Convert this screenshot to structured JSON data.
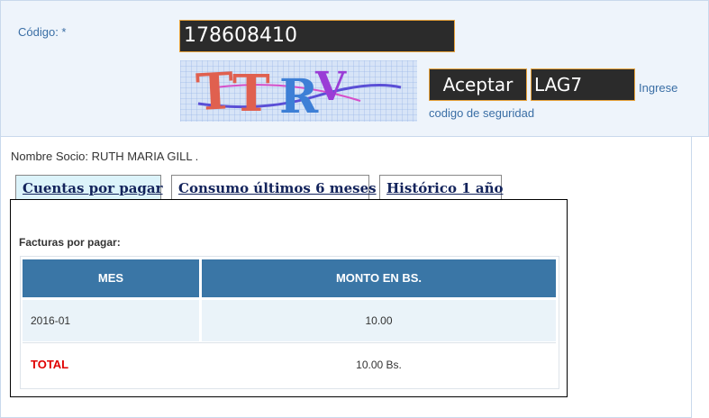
{
  "form": {
    "codigo_label": "Código: *",
    "codigo_value": "178608410",
    "captcha_text": "TTRV",
    "accept_label": "Aceptar",
    "security_value": "LAG7",
    "hint_part1": "Ingrese",
    "hint_part2": "codigo de seguridad"
  },
  "socio": {
    "label": "Nombre Socio: RUTH MARIA GILL ."
  },
  "tabs": [
    {
      "label": "Cuentas por pagar",
      "active": true
    },
    {
      "label": "Consumo últimos 6 meses",
      "active": false
    },
    {
      "label": "Histórico 1 año",
      "active": false
    }
  ],
  "facturas": {
    "title": "Facturas por pagar:",
    "headers": [
      "MES",
      "MONTO EN BS."
    ],
    "rows": [
      {
        "mes": "2016-01",
        "monto": "10.00"
      }
    ],
    "total_label": "TOTAL",
    "total_value": "10.00 Bs."
  },
  "colors": {
    "header_bg": "#3a76a6",
    "total_red": "#e00000",
    "input_border": "#e8a23a",
    "active_tab_bg": "#dcf3fa"
  }
}
